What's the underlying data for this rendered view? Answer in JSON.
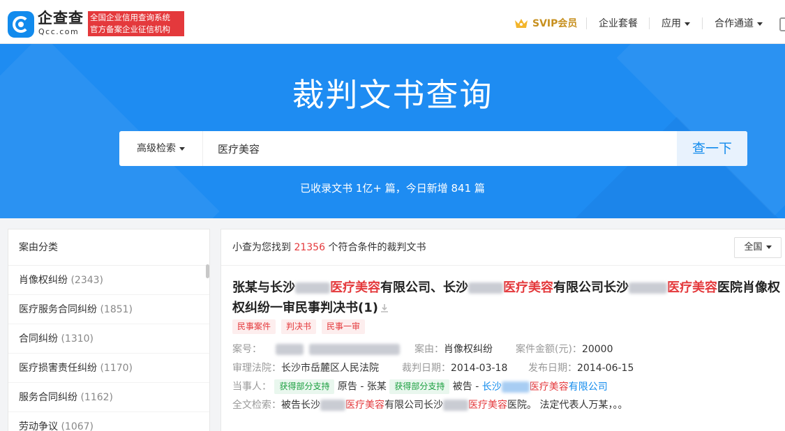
{
  "header": {
    "brand_cn": "企查查",
    "brand_en": "Qcc.com",
    "slogan_line1": "全国企业信用查询系统",
    "slogan_line2": "官方备案企业征信机构",
    "nav": {
      "svip": "SVIP会员",
      "package": "企业套餐",
      "apps": "应用",
      "cooperation": "合作通道"
    }
  },
  "hero": {
    "title": "裁判文书查询",
    "advanced_search": "高级检索",
    "search_value": "医疗美容",
    "search_button": "查一下",
    "stats": "已收录文书 1亿+ 篇，今日新增 841 篇"
  },
  "sidebar": {
    "title": "案由分类",
    "items": [
      {
        "label": "肖像权纠纷",
        "count": "(2343)"
      },
      {
        "label": "医疗服务合同纠纷",
        "count": "(1851)"
      },
      {
        "label": "合同纠纷",
        "count": "(1310)"
      },
      {
        "label": "医疗损害责任纠纷",
        "count": "(1170)"
      },
      {
        "label": "服务合同纠纷",
        "count": "(1162)"
      },
      {
        "label": "劳动争议",
        "count": "(1067)"
      }
    ]
  },
  "results": {
    "summary_prefix": "小查为您找到",
    "summary_count": "21356",
    "summary_suffix": "个符合条件的裁判文书",
    "scope": "全国",
    "item": {
      "title_p1": "张某与长沙",
      "title_p2": "医疗美容",
      "title_p3": "有限公司、长沙",
      "title_p4": "医疗美容",
      "title_p5": "有限公司长沙",
      "title_p6": "医疗美容",
      "title_p7": "医院肖像权",
      "title_line2": "权纠纷一审民事判决书(1)",
      "tags": [
        "民事案件",
        "判决书",
        "民事一审"
      ],
      "case_no_label": "案号：",
      "cause_label": "案由：",
      "cause_value": "肖像权纠纷",
      "amount_label": "案件金额(元)：",
      "amount_value": "20000",
      "court_label": "审理法院：",
      "court_value": "长沙市岳麓区人民法院",
      "judge_date_label": "裁判日期：",
      "judge_date_value": "2014-03-18",
      "publish_date_label": "发布日期：",
      "publish_date_value": "2014-06-15",
      "parties_label": "当事人：",
      "party_tag": "获得部分支持",
      "plaintiff": "原告 - 张某",
      "defendant_prefix": "被告 -",
      "defendant_p1": "长沙",
      "defendant_p2": "医疗美容",
      "defendant_p3": "有限公司",
      "fulltext_label": "全文检索：",
      "fulltext_p1": "被告长沙",
      "fulltext_p2": "医疗美容",
      "fulltext_p3": "有限公司长沙",
      "fulltext_p4": "医疗美容",
      "fulltext_p5": "医院。 法定代表人万某，。。"
    }
  }
}
